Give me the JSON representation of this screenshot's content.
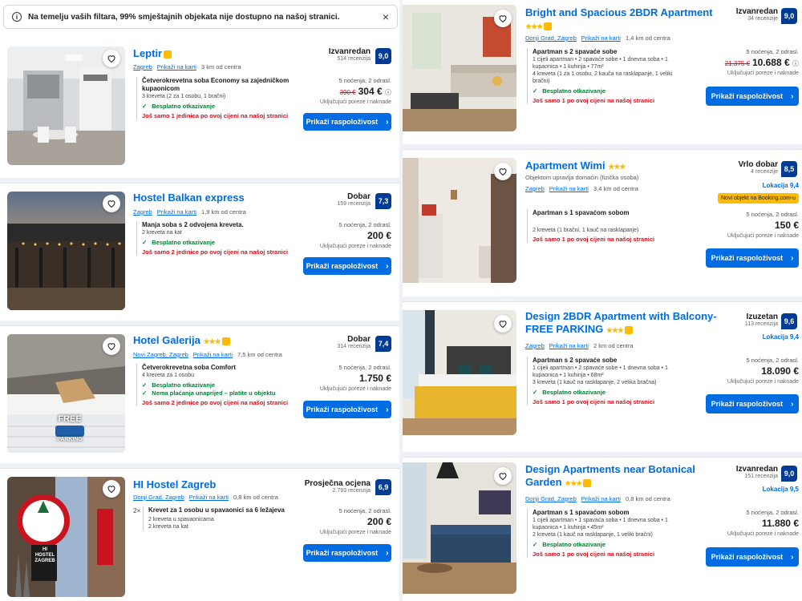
{
  "banner": {
    "text": "Na temelju vaših filtara, 99% smještajnih objekata nije dostupno na našoj stranici.",
    "info_icon": "info-icon",
    "close": "×"
  },
  "common": {
    "map_link": "Prikaži na karti",
    "button": "Prikaži raspoloživost",
    "free_cancel": "Besplatno otkazivanje",
    "tax": "Uključujući poreze i naknade"
  },
  "left": [
    {
      "title": "Leptir",
      "stars": "",
      "loc_city": "Zagreb",
      "distance": "3 km od centra",
      "rating_word": "Izvanredan",
      "reviews": "514 recenzija",
      "score": "9,0",
      "room": "Četverokrevetna soba Economy sa zajedničkom kupaonicom",
      "sub": "3 kreveta (2 za 1 osobu, 1 bračni)",
      "extra": "",
      "only": "Još samo 1 jedinica po ovoj cijeni na našoj stranici",
      "nights": "5 noćenja, 2 odrasl.",
      "old_price": "390 €",
      "price": "304 €"
    },
    {
      "title": "Hostel Balkan express",
      "stars": "",
      "loc_city": "Zagreb",
      "distance": "1,9 km od centra",
      "rating_word": "Dobar",
      "reviews": "159 recenzija",
      "score": "7,3",
      "room": "Manja soba s 2 odvojena kreveta.",
      "sub": "2 kreveta na kat",
      "extra": "",
      "only": "Još samo 2 jedinice po ovoj cijeni na našoj stranici",
      "nights": "5 noćenja, 2 odrasl.",
      "old_price": "",
      "price": "200 €"
    },
    {
      "title": "Hotel Galerija",
      "stars": "★★★",
      "loc_city": "Novi Zagreb, Zagreb",
      "distance": "7,5 km od centra",
      "rating_word": "Dobar",
      "reviews": "314 recenzija",
      "score": "7,4",
      "room": "Četverokrevetna soba Comfort",
      "sub": "4 kreveta za 1 osobu",
      "extra": "Nema plaćanja unaprijed – platite u objektu",
      "only": "Još samo 2 jedinice po ovoj cijeni na našoj stranici",
      "nights": "5 noćenja, 2 odrasl.",
      "old_price": "",
      "price": "1.750 €"
    },
    {
      "title": "HI Hostel Zagreb",
      "stars": "",
      "loc_city": "Donji Grad, Zagreb",
      "distance": "0,8 km od centra",
      "rating_word": "Prosječna ocjena",
      "reviews": "2.793 recenzija",
      "score": "6,9",
      "room": "Krevet za 1 osobu u spavaonici sa 6 ležajeva",
      "sub": "2 kreveta u spavaonicama",
      "sub2": "2 kreveta na kat",
      "qty": "2×",
      "extra": "",
      "only": "",
      "nights": "5 noćenja, 2 odrasl.",
      "old_price": "",
      "price": "200 €"
    }
  ],
  "right": [
    {
      "title": "Bright and Spacious 2BDR Apartment",
      "stars": "★★★",
      "loc_city": "Donji Grad, Zagreb",
      "distance": "1,4 km od centra",
      "rating_word": "Izvanredan",
      "reviews": "34 recenzije",
      "score": "9,0",
      "room": "Apartman s 2 spavaće sobe",
      "sub": "1 cijeli apartman • 2 spavaće sobe • 1 dnevna soba • 1 kupaonica • 1 kuhinja • 77m²",
      "sub2": "4 kreveta (1 za 1 osobu, 2 kauča na rasklapanje, 1 veliki bračni)",
      "only": "Još samo 1 po ovoj cijeni na našoj stranici",
      "nights": "5 noćenja, 2 odrasl.",
      "old_price": "21.375 €",
      "price": "10.688 €"
    },
    {
      "title": "Apartment Wimi",
      "stars": "★★★",
      "host": "Objektom upravlja domaćin (fizička osoba)",
      "loc_city": "Zagreb",
      "distance": "3,4 km od centra",
      "rating_word": "Vrlo dobar",
      "reviews": "4 recenzije",
      "score": "8,5",
      "lokacija": "Lokacija 9,4",
      "badge": "Novi objekt na Booking.com-u",
      "room": "Apartman s 1 spavaćom sobom",
      "sub": "2 kreveta (1 bračni, 1 kauč na rasklapanje)",
      "only": "Još samo 1 po ovoj cijeni na našoj stranici",
      "nights": "5 noćenja, 2 odrasl.",
      "old_price": "",
      "price": "150 €"
    },
    {
      "title": "Design 2BDR Apartment with Balcony-FREE PARKING",
      "stars": "★★★",
      "loc_city": "Zagreb",
      "distance": "2 km od centra",
      "rating_word": "Izuzetan",
      "reviews": "113 recenzija",
      "score": "9,6",
      "lokacija": "Lokacija 9,4",
      "room": "Apartman s 2 spavaće sobe",
      "sub": "1 cijeli apartman • 2 spavaće sobe • 1 dnevna soba • 1 kupaonica • 1 kuhinja • 68m²",
      "sub2": "3 kreveta (1 kauč na rasklapanje, 2 velika bračna)",
      "only": "Još samo 1 po ovoj cijeni na našoj stranici",
      "nights": "5 noćenja, 2 odrasl.",
      "old_price": "",
      "price": "18.090 €"
    },
    {
      "title": "Design Apartments near Botanical Garden",
      "stars": "★★★",
      "loc_city": "Donji Grad, Zagreb",
      "distance": "0,8 km od centra",
      "rating_word": "Izvanredan",
      "reviews": "151 recenzija",
      "score": "9,0",
      "lokacija": "Lokacija 9,5",
      "room": "Apartman s 1 spavaćom sobom",
      "sub": "1 cijeli apartman • 1 spavaća soba • 1 dnevna soba • 1 kupaonica • 1 kuhinja • 45m²",
      "sub2": "2 kreveta (1 kauč na rasklapanje, 1 veliki bračni)",
      "only": "Još samo 1 po ovoj cijeni na našoj stranici",
      "nights": "5 noćenja, 2 odrasl.",
      "old_price": "",
      "price": "11.880 €"
    }
  ]
}
